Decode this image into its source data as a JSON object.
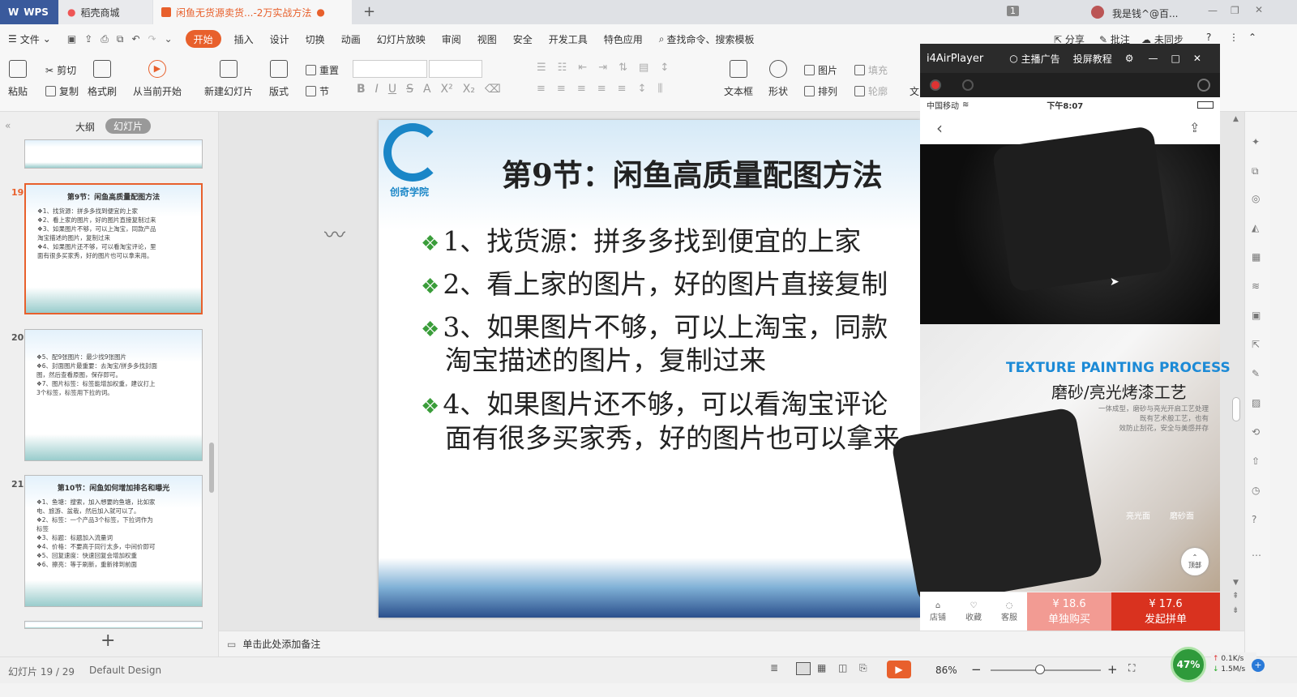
{
  "titlebar": {
    "tabs": [
      {
        "label": "WPS"
      },
      {
        "label": "稻壳商城"
      },
      {
        "label": "闲鱼无货源卖货...-2万实战方法"
      }
    ],
    "page_badge": "1",
    "user": "我是钱^@百..."
  },
  "menubar": {
    "file": "文件",
    "items": [
      "开始",
      "插入",
      "设计",
      "切换",
      "动画",
      "幻灯片放映",
      "审阅",
      "视图",
      "安全",
      "开发工具",
      "特色应用"
    ],
    "search": "查找命令、搜索模板",
    "share": "分享",
    "annotate": "批注",
    "sync": "未同步"
  },
  "ribbon": {
    "paste": "粘贴",
    "cut": "剪切",
    "copy": "复制",
    "format_painter": "格式刷",
    "from_start": "从当前开始",
    "new_slide": "新建幻灯片",
    "layout": "版式",
    "reset": "重置",
    "section": "节",
    "textbox": "文本框",
    "shape": "形状",
    "picture": "图片",
    "fill": "填充",
    "arrange": "排列",
    "outline": "轮廓",
    "text_cut": "文"
  },
  "leftpanel": {
    "tab_outline": "大纲",
    "tab_slides": "幻灯片",
    "thumbs": [
      {
        "num": "19",
        "title": "第9节：闲鱼高质量配图方法",
        "lines": [
          "❖1、找货源：拼多多找到便宜的上家",
          "❖2、看上家的图片，好的图片直接复制过来",
          "❖3、如果图片不够，可以上淘宝，同款产品",
          "淘宝描述的图片，复制过来",
          "❖4、如果图片还不够，可以看淘宝评论，里",
          "面有很多买家秀，好的图片也可以拿来用。"
        ]
      },
      {
        "num": "20",
        "title": "",
        "lines": [
          "❖5、配9张图片：最少找9张图片",
          "❖6、封面图片最重要：去淘宝/拼多多找封面",
          "图，然后查看原图，保存即可。",
          "❖7、图片标签：标签能增加权重，建议打上",
          "3个标签，标签用下拉的词。"
        ]
      },
      {
        "num": "21",
        "title": "第10节：闲鱼如何增加排名和曝光",
        "lines": [
          "❖1、鱼塘：搜索，加入想要的鱼塘，比如家",
          "电、旅游、盆栽，然后加入就可以了。",
          "❖2、标签：一个产品3个标签，下拉词作为",
          "标签",
          "❖3、标题：标题加入流量词",
          "❖4、价格：不要高于同行太多，中间价即可",
          "❖5、回复速度：快速回复会增加权重",
          "❖6、擦亮：等于刷新，重新排到前面"
        ]
      }
    ]
  },
  "slide": {
    "logo_text": "创奇学院",
    "title": "第9节：闲鱼高质量配图方法",
    "bullets": [
      "1、找货源：拼多多找到便宜的上家",
      "2、看上家的图片，好的图片直接复制",
      "3、如果图片不够，可以上淘宝，同款",
      "淘宝描述的图片，复制过来",
      "4、如果图片还不够，可以看淘宝评论",
      "面有很多买家秀，好的图片也可以拿来"
    ]
  },
  "notes": {
    "placeholder": "单击此处添加备注"
  },
  "statusbar": {
    "slide_info": "幻灯片 19 / 29",
    "theme": "Default Design",
    "zoom": "86%",
    "zoom_fraction": 0.45,
    "cpu": "47%",
    "net_up": "0.1K/s",
    "net_down": "1.5M/s"
  },
  "player": {
    "title": "i4AirPlayer",
    "ad": "主播广告",
    "tutorial": "投屏教程",
    "carrier": "中国移动",
    "time": "下午8:07",
    "promo_en": "TEXTURE PAINTING PROCESS",
    "promo_cn": "磨砂/亮光烤漆工艺",
    "promo_desc": [
      "一体成型，磨砂与亮光开启工艺处理",
      "既有艺术般工艺，也有",
      "效防止刮花，安全与美感并存"
    ],
    "label_glossy": "亮光面",
    "label_matte": "磨砂面",
    "top_btn": "顶部",
    "store": "店铺",
    "favorite": "收藏",
    "service": "客服",
    "single_price": "¥ 18.6",
    "single_label": "单独购买",
    "group_price": "¥ 17.6",
    "group_label": "发起拼单"
  },
  "colors": {
    "accent": "#e8602c",
    "green": "#3a9d3a",
    "red": "#d9321f",
    "pink": "#f29b93"
  }
}
